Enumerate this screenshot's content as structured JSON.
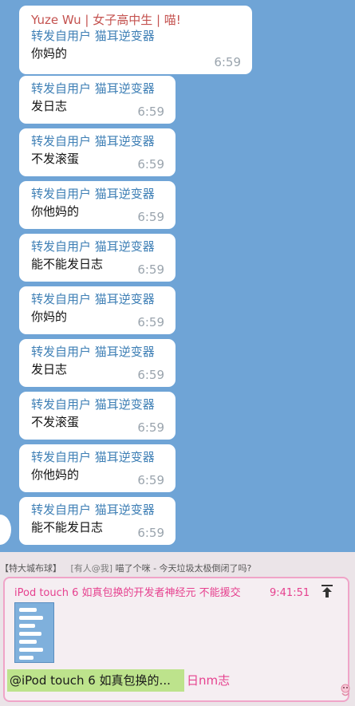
{
  "chat": {
    "first_message": {
      "sender": "Yuze Wu | 女子高中生 | 喵!",
      "forward_label": "转发自用户 猫耳逆变器",
      "text": "你妈的",
      "time": "6:59"
    },
    "messages": [
      {
        "forward_label": "转发自用户 猫耳逆变器",
        "text": "发日志",
        "time": "6:59"
      },
      {
        "forward_label": "转发自用户 猫耳逆变器",
        "text": "不发滚蛋",
        "time": "6:59"
      },
      {
        "forward_label": "转发自用户 猫耳逆变器",
        "text": "你他妈的",
        "time": "6:59"
      },
      {
        "forward_label": "转发自用户 猫耳逆变器",
        "text": "能不能发日志",
        "time": "6:59"
      },
      {
        "forward_label": "转发自用户 猫耳逆变器",
        "text": "你妈的",
        "time": "6:59"
      },
      {
        "forward_label": "转发自用户 猫耳逆变器",
        "text": "发日志",
        "time": "6:59"
      },
      {
        "forward_label": "转发自用户 猫耳逆变器",
        "text": "不发滚蛋",
        "time": "6:59"
      },
      {
        "forward_label": "转发自用户 猫耳逆变器",
        "text": "你他妈的",
        "time": "6:59"
      },
      {
        "forward_label": "转发自用户 猫耳逆变器",
        "text": "能不能发日志",
        "time": "6:59"
      }
    ]
  },
  "notification": {
    "group": "【特大城布球】",
    "tag": "[有人@我]",
    "text": "喵了个咪 - 今天垃圾太极倒闭了吗?"
  },
  "reply_card": {
    "title": "iPod touch 6 如真包换的开发者神经元 不能援交",
    "time": "9:41:51",
    "pin_icon": "pin-top-icon",
    "quote": "@iPod touch 6 如真包换的...",
    "reply_text": "日nm志"
  },
  "colors": {
    "chat_background": "#6fa4d6",
    "sender_name": "#c4524f",
    "forward_label": "#3e7fb5",
    "accent_pink": "#e6418f",
    "quote_highlight": "#bde38c"
  }
}
